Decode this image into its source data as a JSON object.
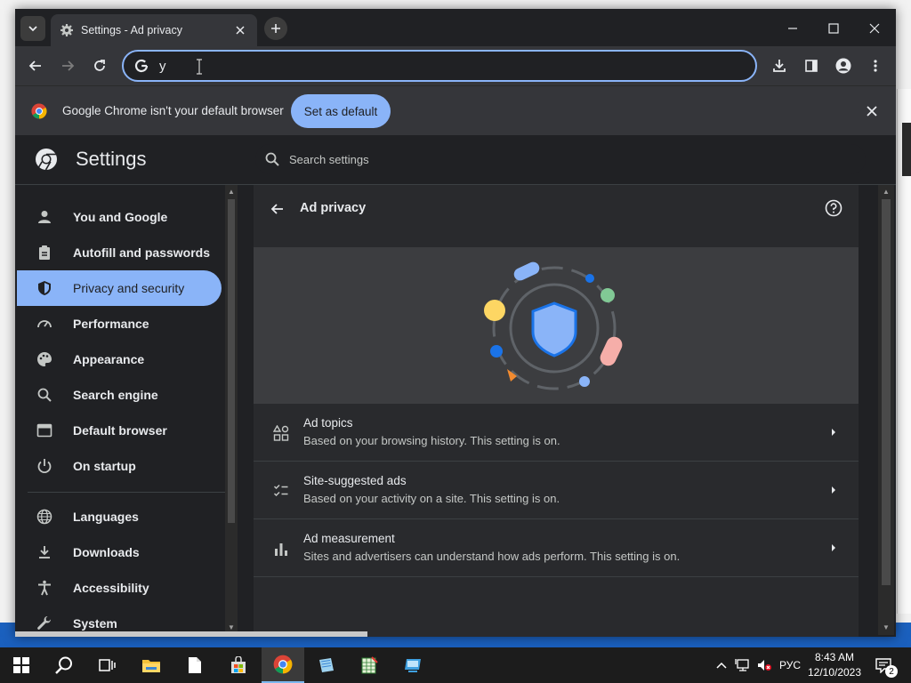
{
  "browser": {
    "tab": {
      "title": "Settings - Ad privacy"
    },
    "omnibox": {
      "value": "y"
    },
    "infobar": {
      "message": "Google Chrome isn't your default browser",
      "button": "Set as default"
    }
  },
  "settings": {
    "title": "Settings",
    "search_placeholder": "Search settings"
  },
  "sidebar": {
    "items": [
      {
        "label": "You and Google",
        "icon": "person-icon"
      },
      {
        "label": "Autofill and passwords",
        "icon": "clipboard-icon"
      },
      {
        "label": "Privacy and security",
        "icon": "shield-icon",
        "active": true
      },
      {
        "label": "Performance",
        "icon": "speedometer-icon"
      },
      {
        "label": "Appearance",
        "icon": "palette-icon"
      },
      {
        "label": "Search engine",
        "icon": "search-icon"
      },
      {
        "label": "Default browser",
        "icon": "browser-window-icon"
      },
      {
        "label": "On startup",
        "icon": "power-icon"
      },
      {
        "label": "Languages",
        "icon": "globe-icon"
      },
      {
        "label": "Downloads",
        "icon": "download-icon"
      },
      {
        "label": "Accessibility",
        "icon": "accessibility-icon"
      },
      {
        "label": "System",
        "icon": "wrench-icon"
      }
    ]
  },
  "page": {
    "title": "Ad privacy",
    "rows": [
      {
        "title": "Ad topics",
        "subtitle": "Based on your browsing history. This setting is on.",
        "icon": "ad-topics-icon"
      },
      {
        "title": "Site-suggested ads",
        "subtitle": "Based on your activity on a site. This setting is on.",
        "icon": "checklist-icon"
      },
      {
        "title": "Ad measurement",
        "subtitle": "Sites and advertisers can understand how ads perform. This setting is on.",
        "icon": "bar-chart-icon"
      }
    ]
  },
  "taskbar": {
    "language": "РУС",
    "time": "8:43 AM",
    "date": "12/10/2023",
    "notifications": "2"
  },
  "colors": {
    "accent": "#8ab4f8",
    "surface": "#292a2d",
    "background": "#202124",
    "text": "#e8eaed"
  }
}
